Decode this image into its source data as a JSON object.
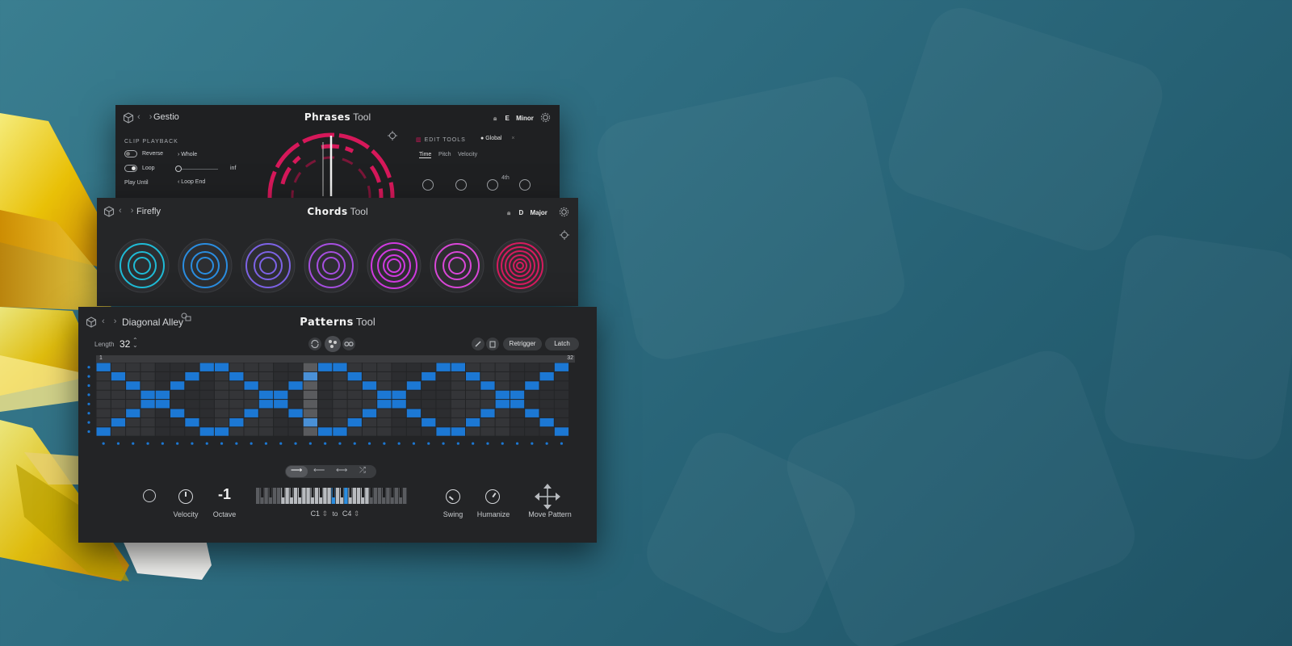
{
  "colors": {
    "accent": "#1c78d4",
    "phrases": "#d6185a",
    "chords": [
      "#1fbbd6",
      "#2a8de0",
      "#7d63e6",
      "#a64fe0",
      "#d03ae0",
      "#d947d8",
      "#d61b5e"
    ]
  },
  "phrases": {
    "preset": "Gestio",
    "title_bold": "Phrases",
    "title_light": "Tool",
    "key_note": "E",
    "key_scale": "Minor",
    "clip_playback": "CLIP PLAYBACK",
    "reverse": "Reverse",
    "reverse_value": "Whole",
    "loop": "Loop",
    "loop_value": "inf",
    "play_until": "Play Until",
    "play_until_value": "Loop End",
    "edit_tools": "EDIT TOOLS",
    "global": "Global",
    "tabs": [
      "Time",
      "Pitch",
      "Velocity"
    ],
    "knob_label": "4th"
  },
  "chords": {
    "preset": "Firefly",
    "title_bold": "Chords",
    "title_light": "Tool",
    "key_note": "D",
    "key_scale": "Major"
  },
  "patterns": {
    "preset": "Diagonal Alley",
    "title_bold": "Patterns",
    "title_light": "Tool",
    "length_label": "Length",
    "length_value": "32",
    "retrigger": "Retrigger",
    "latch": "Latch",
    "ruler_start": "1",
    "ruler_end": "32",
    "velocity": "Velocity",
    "octave_value": "-1",
    "octave": "Octave",
    "range_low": "C1",
    "range_to": "to",
    "range_high": "C4",
    "swing": "Swing",
    "humanize": "Humanize",
    "move_pattern": "Move Pattern",
    "grid": {
      "rows": 8,
      "cols": 32,
      "playhead_col": 14,
      "active": [
        [
          0,
          0
        ],
        [
          0,
          7
        ],
        [
          0,
          8
        ],
        [
          0,
          15
        ],
        [
          0,
          16
        ],
        [
          0,
          23
        ],
        [
          0,
          24
        ],
        [
          0,
          31
        ],
        [
          1,
          1
        ],
        [
          1,
          6
        ],
        [
          1,
          9
        ],
        [
          1,
          14
        ],
        [
          1,
          17
        ],
        [
          1,
          22
        ],
        [
          1,
          25
        ],
        [
          1,
          30
        ],
        [
          2,
          2
        ],
        [
          2,
          5
        ],
        [
          2,
          10
        ],
        [
          2,
          13
        ],
        [
          2,
          18
        ],
        [
          2,
          21
        ],
        [
          2,
          26
        ],
        [
          2,
          29
        ],
        [
          3,
          3
        ],
        [
          3,
          4
        ],
        [
          3,
          11
        ],
        [
          3,
          12
        ],
        [
          3,
          19
        ],
        [
          3,
          20
        ],
        [
          3,
          27
        ],
        [
          3,
          28
        ],
        [
          4,
          3
        ],
        [
          4,
          4
        ],
        [
          4,
          11
        ],
        [
          4,
          12
        ],
        [
          4,
          19
        ],
        [
          4,
          20
        ],
        [
          4,
          27
        ],
        [
          4,
          28
        ],
        [
          5,
          2
        ],
        [
          5,
          5
        ],
        [
          5,
          10
        ],
        [
          5,
          13
        ],
        [
          5,
          18
        ],
        [
          5,
          21
        ],
        [
          5,
          26
        ],
        [
          5,
          29
        ],
        [
          6,
          1
        ],
        [
          6,
          6
        ],
        [
          6,
          9
        ],
        [
          6,
          14
        ],
        [
          6,
          17
        ],
        [
          6,
          22
        ],
        [
          6,
          25
        ],
        [
          6,
          30
        ],
        [
          7,
          0
        ],
        [
          7,
          7
        ],
        [
          7,
          8
        ],
        [
          7,
          15
        ],
        [
          7,
          16
        ],
        [
          7,
          23
        ],
        [
          7,
          24
        ],
        [
          7,
          31
        ]
      ]
    }
  }
}
